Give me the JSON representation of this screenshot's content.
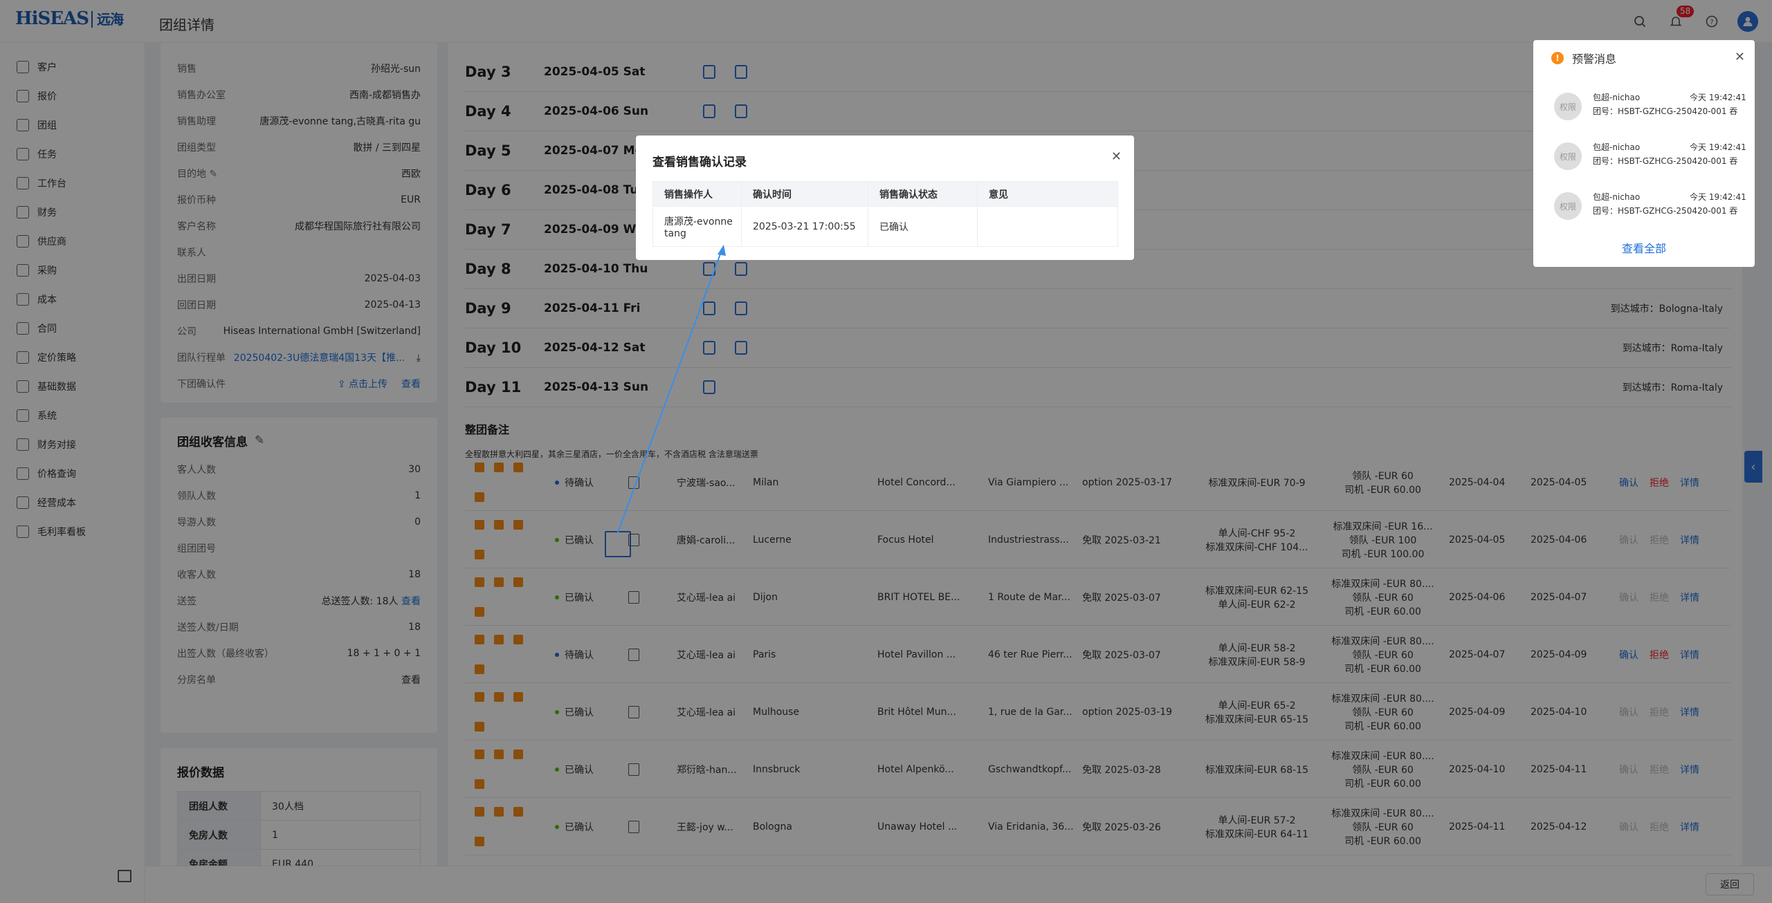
{
  "header": {
    "logo_en": "HiSEAS",
    "logo_cn": "远海",
    "page_title": "团组详情",
    "bell_count": "58"
  },
  "sidebar": {
    "items": [
      {
        "label": "客户",
        "icon": "customer-icon"
      },
      {
        "label": "报价",
        "icon": "quote-icon"
      },
      {
        "label": "团组",
        "icon": "group-icon"
      },
      {
        "label": "任务",
        "icon": "task-icon"
      },
      {
        "label": "工作台",
        "icon": "workbench-icon"
      },
      {
        "label": "财务",
        "icon": "finance-icon"
      },
      {
        "label": "供应商",
        "icon": "supplier-icon"
      },
      {
        "label": "采购",
        "icon": "purchase-icon"
      },
      {
        "label": "成本",
        "icon": "cost-icon"
      },
      {
        "label": "合同",
        "icon": "contract-icon"
      },
      {
        "label": "定价策略",
        "icon": "pricing-icon"
      },
      {
        "label": "基础数据",
        "icon": "data-icon"
      },
      {
        "label": "系统",
        "icon": "system-icon"
      },
      {
        "label": "财务对接",
        "icon": "finance-link-icon"
      },
      {
        "label": "价格查询",
        "icon": "price-search-icon"
      },
      {
        "label": "经营成本",
        "icon": "operating-cost-icon"
      },
      {
        "label": "毛利率看板",
        "icon": "margin-board-icon"
      }
    ]
  },
  "info": {
    "rows": [
      {
        "k": "销售",
        "v": "孙绍光-sun"
      },
      {
        "k": "销售办公室",
        "v": "西南-成都销售办"
      },
      {
        "k": "销售助理",
        "v": "唐源茂-evonne tang,古晓真-rita gu"
      },
      {
        "k": "团组类型",
        "v": "散拼 / 三到四星"
      },
      {
        "k": "目的地",
        "v": "西欧"
      },
      {
        "k": "报价币种",
        "v": "EUR"
      },
      {
        "k": "客户名称",
        "v": "成都华程国际旅行社有限公司"
      },
      {
        "k": "联系人",
        "v": ""
      },
      {
        "k": "出团日期",
        "v": "2025-04-03"
      },
      {
        "k": "回团日期",
        "v": "2025-04-13"
      },
      {
        "k": "公司",
        "v": "Hiseas International GmbH [Switzerland]"
      }
    ],
    "itinerary_label": "团队行程单",
    "itinerary_value": "20250402-3U德法意瑞4国13天【推...",
    "confirm_label": "下团确认件",
    "upload_label": "点击上传",
    "view_label": "查看"
  },
  "guests": {
    "title": "团组收客信息",
    "rows": [
      {
        "k": "客人人数",
        "v": "30"
      },
      {
        "k": "领队人数",
        "v": "1"
      },
      {
        "k": "导游人数",
        "v": "0"
      },
      {
        "k": "组团团号",
        "v": ""
      },
      {
        "k": "收客人数",
        "v": "18"
      }
    ],
    "send_label": "送签",
    "send_value": "总送签人数: 18人",
    "send_link": "查看",
    "send_date_label": "送签人数/日期",
    "send_date_value": "18",
    "depart_label": "出签人数（最终收客）",
    "depart_value": "18 + 1 + 0 + 1",
    "room_label": "分房名单",
    "room_link": "查看"
  },
  "quote": {
    "title": "报价数据",
    "rows": [
      {
        "k": "团组人数",
        "v": "30人档"
      },
      {
        "k": "免房人数",
        "v": "1"
      },
      {
        "k": "免房金额",
        "v": "EUR 440"
      }
    ]
  },
  "days": [
    {
      "n": "Day 3",
      "d": "2025-04-05 Sat",
      "c": ""
    },
    {
      "n": "Day 4",
      "d": "2025-04-06 Sun",
      "c": ""
    },
    {
      "n": "Day 5",
      "d": "2025-04-07 Mon",
      "c": ""
    },
    {
      "n": "Day 6",
      "d": "2025-04-08 Tue",
      "c": ""
    },
    {
      "n": "Day 7",
      "d": "2025-04-09 Wed",
      "c": ""
    },
    {
      "n": "Day 8",
      "d": "2025-04-10 Thu",
      "c": ""
    },
    {
      "n": "Day 9",
      "d": "2025-04-11 Fri",
      "c": "到达城市：Bologna-Italy"
    },
    {
      "n": "Day 10",
      "d": "2025-04-12 Sat",
      "c": "到达城市：Roma-Italy"
    },
    {
      "n": "Day 11",
      "d": "2025-04-13 Sun",
      "c": "到达城市：Roma-Italy"
    }
  ],
  "remark": {
    "title": "整团备注",
    "text": "全程散拼意大利四星，其余三星酒店，一价全含用车，不含酒店税 含法意瑞送票"
  },
  "hotels": [
    {
      "status": "待确认",
      "op": "宁波瑞-sao...",
      "city": "Milan",
      "hotel": "Hotel Concord...",
      "addr": "Via Giampiero ...",
      "opt": "option 2025-03-17",
      "room": [
        "标准双床间-EUR 70-9"
      ],
      "price": [
        "领队 -EUR 60",
        "司机 -EUR 60.00"
      ],
      "in": "2025-04-04",
      "out": "2025-04-05",
      "a1": "确认",
      "a2": "拒绝",
      "a3": "详情"
    },
    {
      "status": "已确认",
      "op": "唐娟-caroli...",
      "city": "Lucerne",
      "hotel": "Focus Hotel",
      "addr": "Industriestrass...",
      "opt": "免取 2025-03-21",
      "room": [
        "单人间-CHF 95-2",
        "标准双床间-CHF 104..."
      ],
      "price": [
        "标准双床间 -EUR 16...",
        "领队 -EUR 100",
        "司机 -EUR 100.00"
      ],
      "in": "2025-04-05",
      "out": "2025-04-06",
      "a1": "确认",
      "a2": "拒绝",
      "a3": "详情"
    },
    {
      "status": "已确认",
      "op": "艾心瑶-lea ai",
      "city": "Dijon",
      "hotel": "BRIT HOTEL BE...",
      "addr": "1 Route de Mar...",
      "opt": "免取 2025-03-07",
      "room": [
        "标准双床间-EUR 62-15",
        "单人间-EUR 62-2"
      ],
      "price": [
        "标准双床间 -EUR 80....",
        "领队 -EUR 60",
        "司机 -EUR 60.00"
      ],
      "in": "2025-04-06",
      "out": "2025-04-07",
      "a1": "确认",
      "a2": "拒绝",
      "a3": "详情"
    },
    {
      "status": "待确认",
      "op": "艾心瑶-lea ai",
      "city": "Paris",
      "hotel": "Hotel Pavillon ...",
      "addr": "46 ter Rue Pierr...",
      "opt": "免取 2025-03-07",
      "room": [
        "单人间-EUR 58-2",
        "标准双床间-EUR 58-9"
      ],
      "price": [
        "标准双床间 -EUR 80....",
        "领队 -EUR 60",
        "司机 -EUR 60.00"
      ],
      "in": "2025-04-07",
      "out": "2025-04-09",
      "a1": "确认",
      "a2": "拒绝",
      "a3": "详情"
    },
    {
      "status": "已确认",
      "op": "艾心瑶-lea ai",
      "city": "Mulhouse",
      "hotel": "Brit Hôtel Mun...",
      "addr": "1, rue de la Gar...",
      "opt": "option 2025-03-19",
      "room": [
        "单人间-EUR 65-2",
        "标准双床间-EUR 65-15"
      ],
      "price": [
        "标准双床间 -EUR 80....",
        "领队 -EUR 60",
        "司机 -EUR 60.00"
      ],
      "in": "2025-04-09",
      "out": "2025-04-10",
      "a1": "确认",
      "a2": "拒绝",
      "a3": "详情"
    },
    {
      "status": "已确认",
      "op": "郑衍晗-han...",
      "city": "Innsbruck",
      "hotel": "Hotel Alpenkö...",
      "addr": "Gschwandtkopf...",
      "opt": "免取 2025-03-28",
      "room": [
        "标准双床间-EUR 68-15"
      ],
      "price": [
        "标准双床间 -EUR 80....",
        "领队 -EUR 60",
        "司机 -EUR 60.00"
      ],
      "in": "2025-04-10",
      "out": "2025-04-11",
      "a1": "确认",
      "a2": "拒绝",
      "a3": "详情"
    },
    {
      "status": "已确认",
      "op": "王懿-joy w...",
      "city": "Bologna",
      "hotel": "Unaway Hotel ...",
      "addr": "Via Eridania, 36...",
      "opt": "免取 2025-03-26",
      "room": [
        "单人间-EUR 57-2",
        "标准双床间-EUR 64-11"
      ],
      "price": [
        "标准双床间 -EUR 80....",
        "领队 -EUR 60",
        "司机 -EUR 60.00"
      ],
      "in": "2025-04-11",
      "out": "2025-04-12",
      "a1": "确认",
      "a2": "拒绝",
      "a3": "详情"
    }
  ],
  "back_label": "返回",
  "alert": {
    "title": "预警消息",
    "items": [
      {
        "avatar": "权限",
        "name": "包超-nichao",
        "time": "今天 19:42:41",
        "text": "团号：HSBT-GZHCG-250420-001 吞"
      },
      {
        "avatar": "权限",
        "name": "包超-nichao",
        "time": "今天 19:42:41",
        "text": "团号：HSBT-GZHCG-250420-001 吞"
      },
      {
        "avatar": "权限",
        "name": "包超-nichao",
        "time": "今天 19:42:41",
        "text": "团号：HSBT-GZHCG-250420-001 吞"
      }
    ],
    "view_all": "查看全部"
  },
  "modal": {
    "title": "查看销售确认记录",
    "headers": [
      "销售操作人",
      "确认时间",
      "销售确认状态",
      "意见"
    ],
    "row": {
      "operator": "唐源茂-evonne tang",
      "time": "2025-03-21 17:00:55",
      "status": "已确认",
      "comment": ""
    }
  }
}
